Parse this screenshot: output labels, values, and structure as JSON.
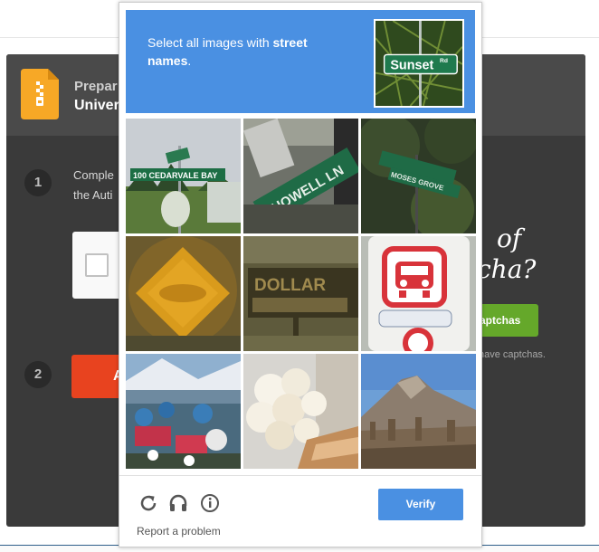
{
  "background": {
    "title_line_1": "Prepar",
    "title_line_2": "Univer",
    "step_1_number": "1",
    "step_1_text": "Comple\nthe Auti",
    "step_2_number": "2",
    "red_button_label": "A",
    "cursive_line_1": "of",
    "cursive_line_2": "cha?",
    "green_button_label": "aptchas",
    "small_text": "have captchas."
  },
  "captcha": {
    "instruction_prefix": "Select all images with ",
    "instruction_target": "street names",
    "instruction_suffix": ".",
    "example_sign_text": "Sunset",
    "example_sign_suffix": "Rd",
    "tiles": [
      {
        "description": "street-sign-cedarvale"
      },
      {
        "description": "street-sign-howell"
      },
      {
        "description": "street-sign-moses-grove"
      },
      {
        "description": "blurry-yellow-sign"
      },
      {
        "description": "blurry-dollar-sign"
      },
      {
        "description": "bus-sign"
      },
      {
        "description": "flower-market"
      },
      {
        "description": "white-roses"
      },
      {
        "description": "mountain-landscape"
      }
    ],
    "tile_sign_texts": [
      "100 CEDARVALE BAY",
      "HOWELL LN",
      "MOSES GROVE",
      "",
      "DOLLAR",
      "",
      "",
      "",
      ""
    ],
    "report_label": "Report a problem",
    "verify_label": "Verify"
  },
  "colors": {
    "accent": "#4a90e2",
    "panel": "#3a3a3a",
    "green": "#65a82a",
    "red": "#e8431f"
  }
}
